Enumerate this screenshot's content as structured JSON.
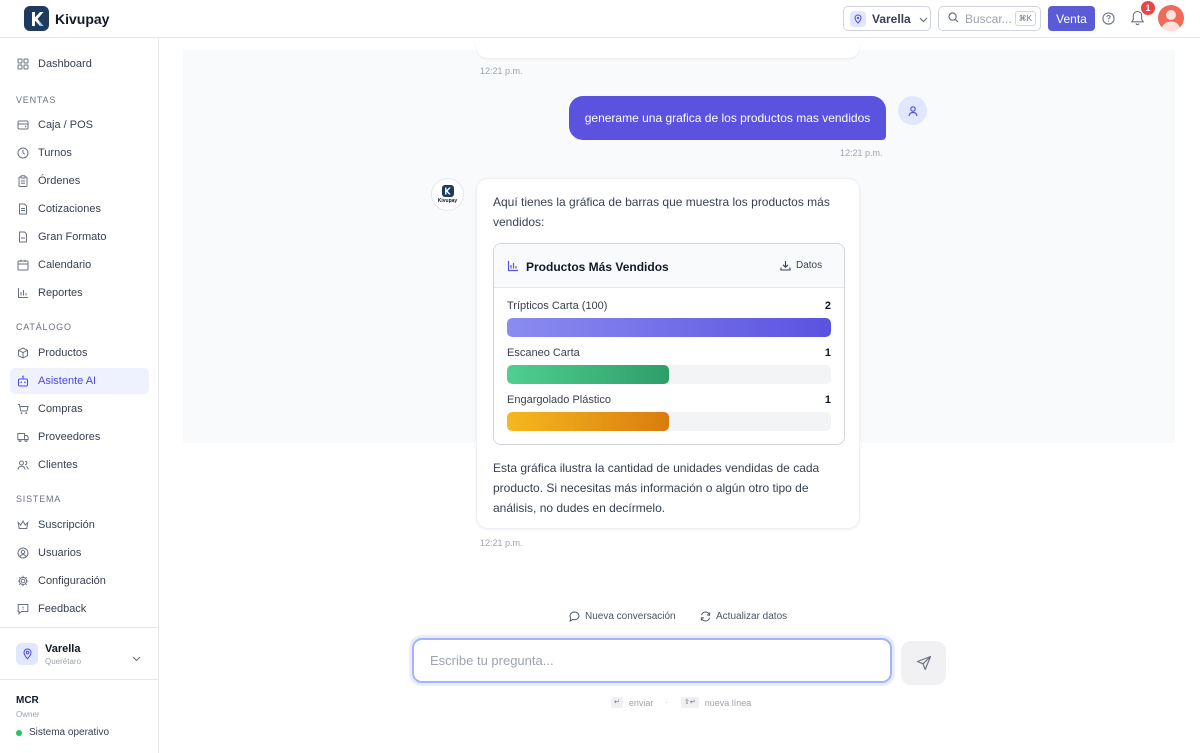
{
  "app": {
    "name": "Kivupay"
  },
  "topbar": {
    "branch": "Varella",
    "search_placeholder": "Buscar...",
    "search_shortcut": "⌘K",
    "sale_button": "Venta",
    "notification_count": "1"
  },
  "sidebar": {
    "dashboard": "Dashboard",
    "sections": {
      "ventas": "VENTAS",
      "catalogo": "CATÁLOGO",
      "sistema": "SISTEMA"
    },
    "ventas_items": [
      "Caja / POS",
      "Turnos",
      "Órdenes",
      "Cotizaciones",
      "Gran Formato",
      "Calendario",
      "Reportes"
    ],
    "catalogo_items": [
      "Productos",
      "Asistente AI",
      "Compras",
      "Proveedores",
      "Clientes"
    ],
    "sistema_items": [
      "Suscripción",
      "Usuarios",
      "Configuración",
      "Feedback"
    ],
    "active_item": "Asistente AI",
    "branch_card": {
      "name": "Varella",
      "city": "Querétaro"
    },
    "user": {
      "code": "MCR",
      "role": "Owner"
    },
    "status": "Sistema operativo",
    "status_color": "#22c55e"
  },
  "chat": {
    "time_prev": "12:21 p.m.",
    "user_message": "generame una grafica de los productos mas vendidos",
    "user_time": "12:21 p.m.",
    "bot_intro": "Aquí tienes la gráfica de barras que muestra los productos más vendidos:",
    "bot_outro": "Esta gráfica ilustra la cantidad de unidades vendidas de cada producto. Si necesitas más información o algún otro tipo de análisis, no dudes en decírmelo.",
    "bot_time": "12:21 p.m.",
    "bot_avatar_label": "Kivupay",
    "chart_card": {
      "title": "Productos Más Vendidos",
      "download_label": "Datos"
    }
  },
  "chart_data": {
    "type": "bar",
    "orientation": "horizontal",
    "title": "Productos Más Vendidos",
    "categories": [
      "Trípticos Carta (100)",
      "Escaneo Carta",
      "Engargolado Plástico"
    ],
    "values": [
      2,
      1,
      1
    ],
    "xlim": [
      0,
      2
    ],
    "colors": [
      [
        "#8b8cf0",
        "#5b52e0"
      ],
      [
        "#4fcf92",
        "#2e9e68"
      ],
      [
        "#f5b81f",
        "#d97c0e"
      ]
    ],
    "grid": false
  },
  "footer": {
    "new_conversation": "Nueva conversación",
    "refresh_data": "Actualizar datos",
    "input_placeholder": "Escribe tu pregunta...",
    "hint_enter_key": "↵",
    "hint_enter": "enviar",
    "hint_shift_key": "⇧↵",
    "hint_newline": "nueva línea"
  },
  "colors": {
    "accent": "#5b52e0",
    "button": "#5b5bd6",
    "badge": "#ef4444"
  }
}
